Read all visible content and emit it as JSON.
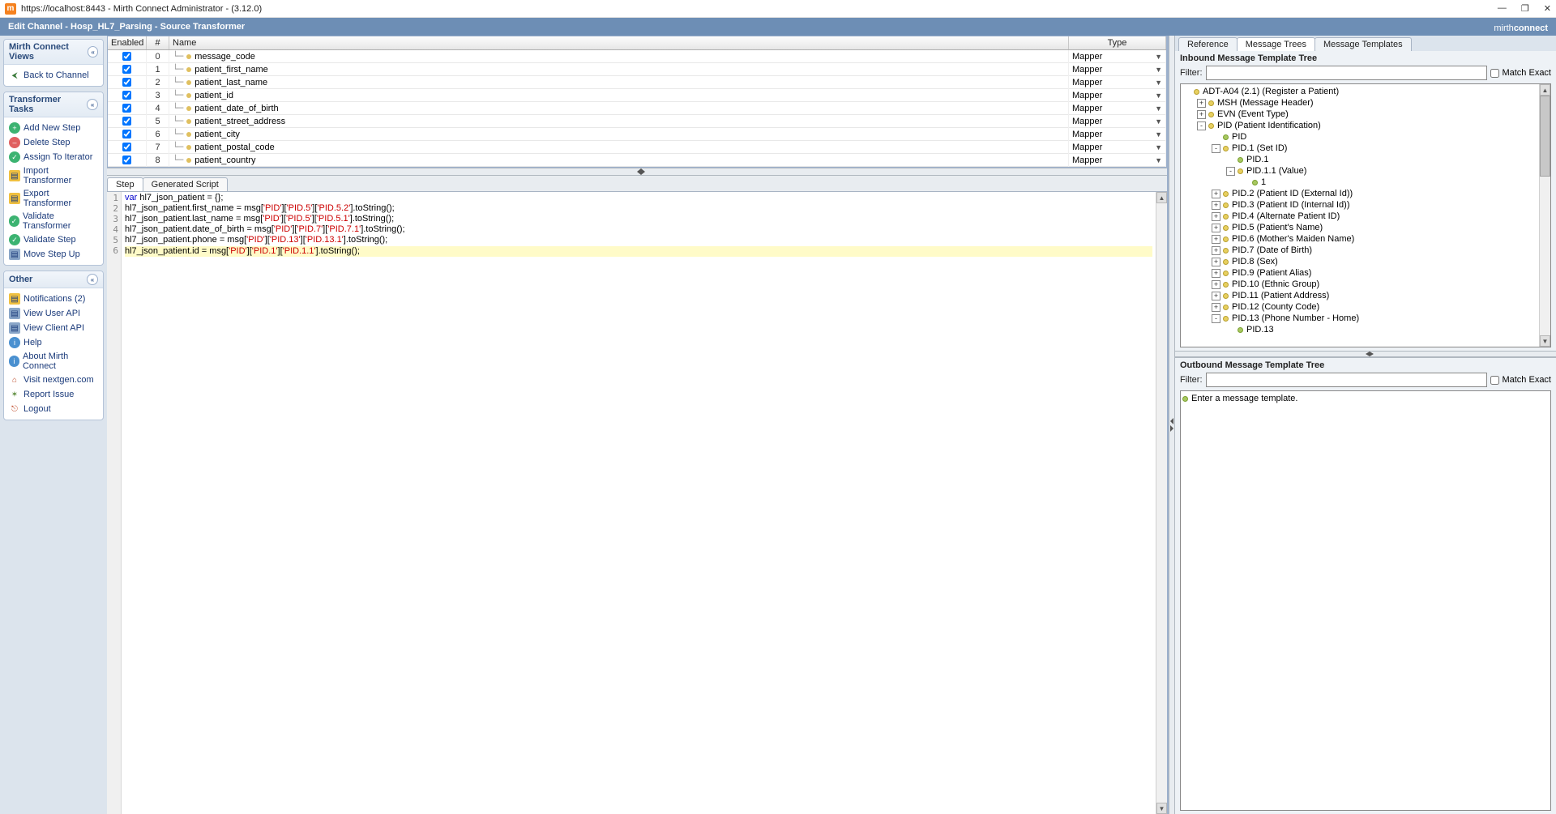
{
  "window": {
    "title": "https://localhost:8443 - Mirth Connect Administrator - (3.12.0)"
  },
  "header": {
    "title": "Edit Channel - Hosp_HL7_Parsing - Source Transformer",
    "logo_left": "mirth",
    "logo_right": "connect"
  },
  "sidebar": {
    "views": {
      "title": "Mirth Connect Views",
      "back": "Back to Channel"
    },
    "tasks": {
      "title": "Transformer Tasks",
      "items": [
        {
          "label": "Add New Step",
          "icon": "add"
        },
        {
          "label": "Delete Step",
          "icon": "del"
        },
        {
          "label": "Assign To Iterator",
          "icon": "ok"
        },
        {
          "label": "Import Transformer",
          "icon": "doc"
        },
        {
          "label": "Export Transformer",
          "icon": "doc"
        },
        {
          "label": "Validate Transformer",
          "icon": "ok"
        },
        {
          "label": "Validate Step",
          "icon": "ok"
        },
        {
          "label": "Move Step Up",
          "icon": "doc2"
        }
      ]
    },
    "other": {
      "title": "Other",
      "items": [
        {
          "label": "Notifications (2)",
          "icon": "doc"
        },
        {
          "label": "View User API",
          "icon": "doc2"
        },
        {
          "label": "View Client API",
          "icon": "doc2"
        },
        {
          "label": "Help",
          "icon": "info"
        },
        {
          "label": "About Mirth Connect",
          "icon": "info"
        },
        {
          "label": "Visit nextgen.com",
          "icon": "home"
        },
        {
          "label": "Report Issue",
          "icon": "bug"
        },
        {
          "label": "Logout",
          "icon": "out"
        }
      ]
    }
  },
  "steps": {
    "headers": {
      "enabled": "Enabled",
      "num": "#",
      "name": "Name",
      "type": "Type"
    },
    "rows": [
      {
        "num": "0",
        "name": "message_code",
        "type": "Mapper"
      },
      {
        "num": "1",
        "name": "patient_first_name",
        "type": "Mapper"
      },
      {
        "num": "2",
        "name": "patient_last_name",
        "type": "Mapper"
      },
      {
        "num": "3",
        "name": "patient_id",
        "type": "Mapper"
      },
      {
        "num": "4",
        "name": "patient_date_of_birth",
        "type": "Mapper"
      },
      {
        "num": "5",
        "name": "patient_street_address",
        "type": "Mapper"
      },
      {
        "num": "6",
        "name": "patient_city",
        "type": "Mapper"
      },
      {
        "num": "7",
        "name": "patient_postal_code",
        "type": "Mapper"
      },
      {
        "num": "8",
        "name": "patient_country",
        "type": "Mapper"
      }
    ]
  },
  "code_tabs": {
    "step": "Step",
    "script": "Generated Script"
  },
  "code": {
    "lines": [
      {
        "n": "1",
        "pre": "",
        "kw": "var",
        "mid": " hl7_json_patient = {};"
      },
      {
        "n": "2",
        "pre": "hl7_json_patient.first_name = ",
        "call": "msg",
        "args": "['PID']['PID.5']['PID.5.2']",
        "post": ".toString();"
      },
      {
        "n": "3",
        "pre": "hl7_json_patient.last_name = ",
        "call": "msg",
        "args": "['PID']['PID.5']['PID.5.1']",
        "post": ".toString();"
      },
      {
        "n": "4",
        "pre": "hl7_json_patient.date_of_birth = ",
        "call": "msg",
        "args": "['PID']['PID.7']['PID.7.1']",
        "post": ".toString();"
      },
      {
        "n": "5",
        "pre": "hl7_json_patient.phone = ",
        "call": "msg",
        "args": "['PID']['PID.13']['PID.13.1']",
        "post": ".toString();"
      },
      {
        "n": "6",
        "pre": "hl7_json_patient.id = ",
        "call": "msg",
        "args": "['PID']['PID.1']['PID.1.1']",
        "post": ".toString();",
        "hl": true
      }
    ]
  },
  "right": {
    "tabs": {
      "reference": "Reference",
      "trees": "Message Trees",
      "templates": "Message Templates"
    },
    "inbound": {
      "title": "Inbound Message Template Tree",
      "filter_label": "Filter:",
      "match_exact": "Match Exact",
      "nodes": [
        {
          "ind": 0,
          "exp": "",
          "dot": "y",
          "label": "ADT-A04 (2.1) (Register a Patient)"
        },
        {
          "ind": 1,
          "exp": "+",
          "dot": "y",
          "label": "MSH (Message Header)"
        },
        {
          "ind": 1,
          "exp": "+",
          "dot": "y",
          "label": "EVN (Event Type)"
        },
        {
          "ind": 1,
          "exp": "-",
          "dot": "y",
          "label": "PID (Patient Identification)"
        },
        {
          "ind": 2,
          "exp": "",
          "dot": "g",
          "label": "PID"
        },
        {
          "ind": 2,
          "exp": "-",
          "dot": "y",
          "label": "PID.1 (Set ID)"
        },
        {
          "ind": 3,
          "exp": "",
          "dot": "g",
          "label": "PID.1"
        },
        {
          "ind": 3,
          "exp": "-",
          "dot": "y",
          "label": "PID.1.1 (Value)"
        },
        {
          "ind": 4,
          "exp": "",
          "dot": "g",
          "label": "1"
        },
        {
          "ind": 2,
          "exp": "+",
          "dot": "y",
          "label": "PID.2 (Patient ID (External Id))"
        },
        {
          "ind": 2,
          "exp": "+",
          "dot": "y",
          "label": "PID.3 (Patient ID (Internal Id))"
        },
        {
          "ind": 2,
          "exp": "+",
          "dot": "y",
          "label": "PID.4 (Alternate Patient ID)"
        },
        {
          "ind": 2,
          "exp": "+",
          "dot": "y",
          "label": "PID.5 (Patient's Name)"
        },
        {
          "ind": 2,
          "exp": "+",
          "dot": "y",
          "label": "PID.6 (Mother's Maiden Name)"
        },
        {
          "ind": 2,
          "exp": "+",
          "dot": "y",
          "label": "PID.7 (Date of Birth)"
        },
        {
          "ind": 2,
          "exp": "+",
          "dot": "y",
          "label": "PID.8 (Sex)"
        },
        {
          "ind": 2,
          "exp": "+",
          "dot": "y",
          "label": "PID.9 (Patient Alias)"
        },
        {
          "ind": 2,
          "exp": "+",
          "dot": "y",
          "label": "PID.10 (Ethnic Group)"
        },
        {
          "ind": 2,
          "exp": "+",
          "dot": "y",
          "label": "PID.11 (Patient Address)"
        },
        {
          "ind": 2,
          "exp": "+",
          "dot": "y",
          "label": "PID.12 (County Code)"
        },
        {
          "ind": 2,
          "exp": "-",
          "dot": "y",
          "label": "PID.13 (Phone Number - Home)"
        },
        {
          "ind": 3,
          "exp": "",
          "dot": "g",
          "label": "PID.13"
        }
      ]
    },
    "outbound": {
      "title": "Outbound Message Template Tree",
      "filter_label": "Filter:",
      "match_exact": "Match Exact",
      "placeholder": "Enter a message template."
    }
  }
}
